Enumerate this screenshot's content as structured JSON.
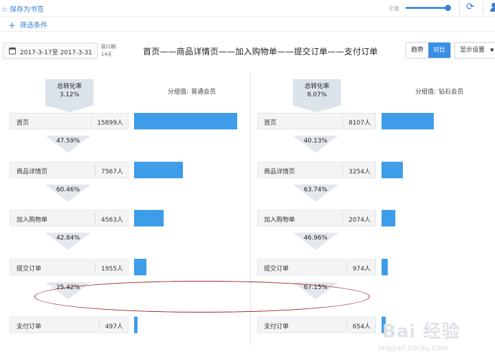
{
  "toolbar": {
    "bookmark_label": "保存为书签",
    "zoom_label": "全量",
    "zoom_fraction": 0.95
  },
  "filter": {
    "add_label": "筛选条件"
  },
  "date_range": {
    "value": "2017-3-17至 2017-3-31"
  },
  "window": {
    "label": "窗口期:",
    "value": "14天"
  },
  "funnel_title": "首页——商品详情页——加入购物单——提交订单——支付订单",
  "view_buttons": {
    "trend": "趋势",
    "compare": "对比",
    "display": "显示设置"
  },
  "groups": [
    {
      "conv_label": "总转化率",
      "conv_value": "3.12%",
      "group_label": "分组值:",
      "group_value": "普通会员",
      "steps": [
        {
          "name": "首页",
          "count": "15899人",
          "value": 15899
        },
        {
          "name": "商品详情页",
          "count": "7567人",
          "value": 7567
        },
        {
          "name": "加入购物单",
          "count": "4563人",
          "value": 4563
        },
        {
          "name": "提交订单",
          "count": "1955人",
          "value": 1955
        },
        {
          "name": "支付订单",
          "count": "497人",
          "value": 497
        }
      ],
      "rates": [
        "47.59%",
        "60.46%",
        "42.84%",
        "25.42%"
      ]
    },
    {
      "conv_label": "总转化率",
      "conv_value": "8.07%",
      "group_label": "分组值:",
      "group_value": "钻石会员",
      "steps": [
        {
          "name": "首页",
          "count": "8107人",
          "value": 8107
        },
        {
          "name": "商品详情页",
          "count": "3254人",
          "value": 3254
        },
        {
          "name": "加入购物单",
          "count": "2074人",
          "value": 2074
        },
        {
          "name": "提交订单",
          "count": "974人",
          "value": 974
        },
        {
          "name": "支付订单",
          "count": "654人",
          "value": 654
        }
      ],
      "rates": [
        "40.13%",
        "63.74%",
        "46.96%",
        "67.15%"
      ]
    }
  ],
  "colors": {
    "bar": "#3e9de8",
    "accent": "#3a7fd0",
    "highlight_ellipse": "#a02525"
  },
  "watermark": {
    "brand": "Bai 经验",
    "url": "jingyan.baidu.com"
  }
}
